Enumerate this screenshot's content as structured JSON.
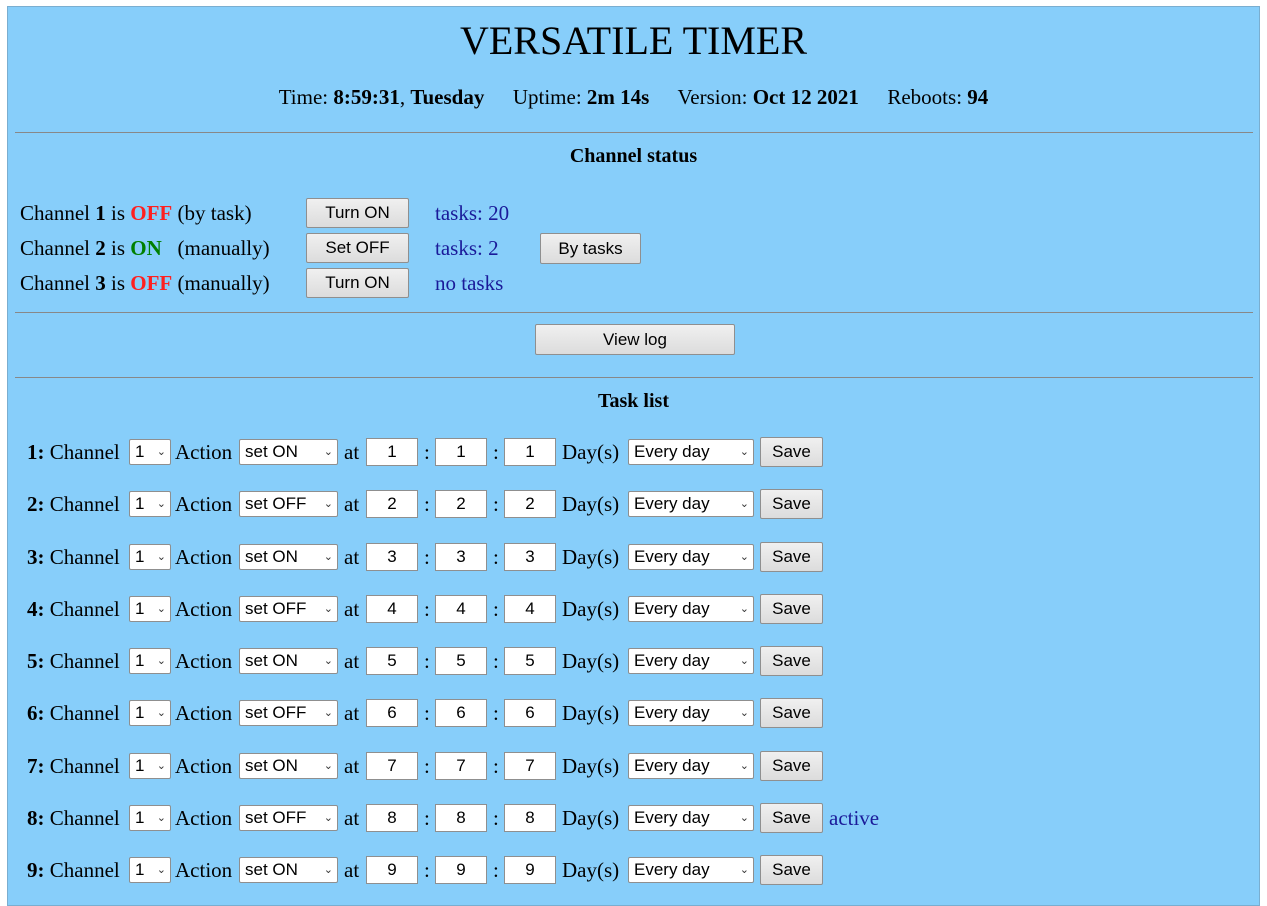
{
  "header": {
    "title": "VERSATILE TIMER",
    "time_label": "Time:",
    "time_value": "8:59:31",
    "day_value": "Tuesday",
    "uptime_label": "Uptime:",
    "uptime_value": "2m 14s",
    "version_label": "Version:",
    "version_value": "Oct 12 2021",
    "reboots_label": "Reboots:",
    "reboots_value": "94"
  },
  "channel_status": {
    "title": "Channel status",
    "channels": [
      {
        "prefix": "Channel",
        "num": "1",
        "is": "is",
        "state": "OFF",
        "mode": "(by task)",
        "button": "Turn ON",
        "tasks": "tasks: 20"
      },
      {
        "prefix": "Channel",
        "num": "2",
        "is": "is",
        "state": "ON",
        "mode": "(manually)",
        "button": "Set OFF",
        "tasks": "tasks: 2",
        "extra_button": "By tasks"
      },
      {
        "prefix": "Channel",
        "num": "3",
        "is": "is",
        "state": "OFF",
        "mode": "(manually)",
        "button": "Turn ON",
        "tasks": "no tasks"
      }
    ],
    "view_log": "View log"
  },
  "task_list": {
    "title": "Task list",
    "channel_label": "Channel",
    "action_label": "Action",
    "at_label": "at",
    "colon": ":",
    "days_label": "Day(s)",
    "save_label": "Save",
    "tasks": [
      {
        "index": "1:",
        "channel": "1",
        "action": "set ON",
        "h": "1",
        "m": "1",
        "s": "1",
        "days": "Every day"
      },
      {
        "index": "2:",
        "channel": "1",
        "action": "set OFF",
        "h": "2",
        "m": "2",
        "s": "2",
        "days": "Every day"
      },
      {
        "index": "3:",
        "channel": "1",
        "action": "set ON",
        "h": "3",
        "m": "3",
        "s": "3",
        "days": "Every day"
      },
      {
        "index": "4:",
        "channel": "1",
        "action": "set OFF",
        "h": "4",
        "m": "4",
        "s": "4",
        "days": "Every day"
      },
      {
        "index": "5:",
        "channel": "1",
        "action": "set ON",
        "h": "5",
        "m": "5",
        "s": "5",
        "days": "Every day"
      },
      {
        "index": "6:",
        "channel": "1",
        "action": "set OFF",
        "h": "6",
        "m": "6",
        "s": "6",
        "days": "Every day"
      },
      {
        "index": "7:",
        "channel": "1",
        "action": "set ON",
        "h": "7",
        "m": "7",
        "s": "7",
        "days": "Every day"
      },
      {
        "index": "8:",
        "channel": "1",
        "action": "set OFF",
        "h": "8",
        "m": "8",
        "s": "8",
        "days": "Every day",
        "status": "active"
      },
      {
        "index": "9:",
        "channel": "1",
        "action": "set ON",
        "h": "9",
        "m": "9",
        "s": "9",
        "days": "Every day"
      }
    ]
  }
}
